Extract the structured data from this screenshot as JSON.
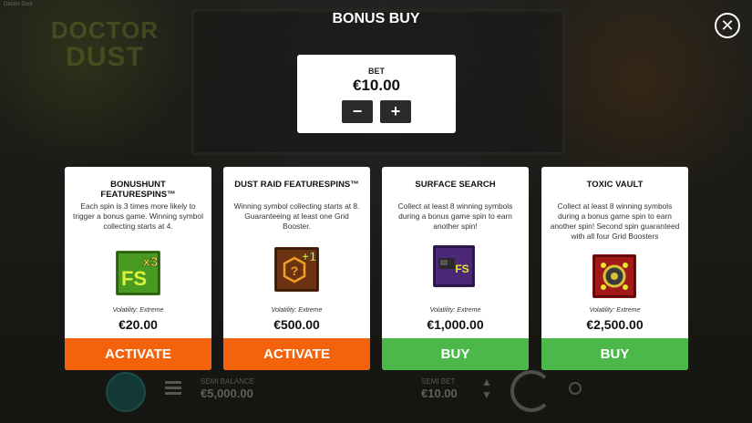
{
  "window": {
    "title": "Doctor Dust"
  },
  "background": {
    "logo_line1": "DOCTOR",
    "logo_line2": "DUST",
    "cash_label": "SEMI BALANCE",
    "cash_value": "€5,000.00",
    "bet_label": "SEMI BET",
    "bet_value": "€10.00"
  },
  "modal": {
    "title": "BONUS BUY",
    "close_symbol": "✕"
  },
  "bet": {
    "label": "BET",
    "amount": "€10.00",
    "minus": "−",
    "plus": "+"
  },
  "cards": [
    {
      "title": "BONUSHUNT FEATURESPINS™",
      "description": "Each spin is 3 times more likely to trigger a bonus game. Winning symbol collecting starts at 4.",
      "icon": "fs-x3-icon",
      "icon_text": "FS",
      "icon_badge": "x3",
      "volatility": "Volatility: Extreme",
      "price": "€20.00",
      "action": "ACTIVATE",
      "action_color": "#f4620c"
    },
    {
      "title": "DUST RAID FEATURESPINS™",
      "description": "Winning symbol collecting starts at 8. Guaranteeing at least one Grid Booster.",
      "icon": "grid-booster-plus1-icon",
      "icon_text": "?",
      "icon_badge": "+1",
      "volatility": "Volatility: Extreme",
      "price": "€500.00",
      "action": "ACTIVATE",
      "action_color": "#f4620c"
    },
    {
      "title": "SURFACE SEARCH",
      "description": "Collect at least 8 winning symbols during a bonus game spin to earn another spin!",
      "icon": "surface-search-fs-icon",
      "icon_text": "FS",
      "icon_badge": "",
      "volatility": "Volatility: Extreme",
      "price": "€1,000.00",
      "action": "BUY",
      "action_color": "#4db84a"
    },
    {
      "title": "TOXIC VAULT",
      "description": "Collect at least 8 winning symbols during a bonus game spin to earn another spin! Second spin guaranteed with all four Grid Boosters",
      "icon": "toxic-vault-icon",
      "icon_text": "",
      "icon_badge": "",
      "volatility": "Volatility: Extreme",
      "price": "€2,500.00",
      "action": "BUY",
      "action_color": "#4db84a"
    }
  ]
}
